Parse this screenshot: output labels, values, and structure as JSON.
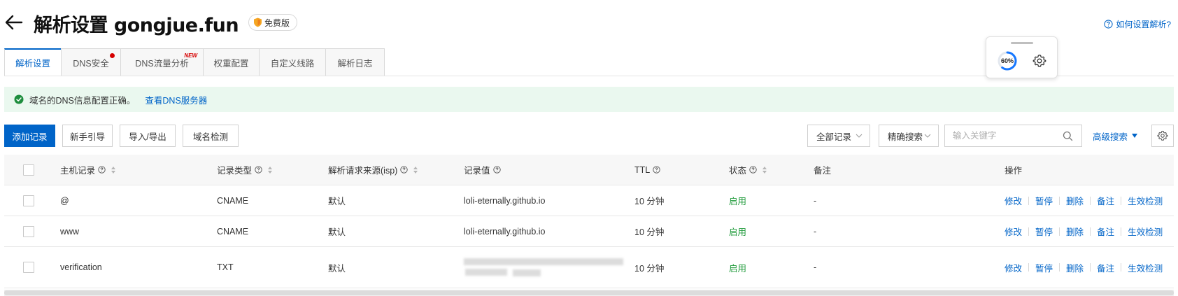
{
  "header": {
    "title": "解析设置 gongjue.fun",
    "edition_badge": "免费版",
    "help_link": "如何设置解析?"
  },
  "tabs": [
    {
      "label": "解析设置",
      "active": true
    },
    {
      "label": "DNS安全",
      "has_dot": true
    },
    {
      "label": "DNS流量分析",
      "badge": "NEW"
    },
    {
      "label": "权重配置"
    },
    {
      "label": "自定义线路"
    },
    {
      "label": "解析日志"
    }
  ],
  "widget": {
    "progress_label": "60%",
    "progress_value": 0.6,
    "icon": "gear-icon"
  },
  "alert": {
    "message": "域名的DNS信息配置正确。",
    "link": "查看DNS服务器"
  },
  "toolbar": {
    "add_record": "添加记录",
    "beginner_guide": "新手引导",
    "import_export": "导入/导出",
    "domain_check": "域名检测",
    "filter_select": "全部记录",
    "search_mode_select": "精确搜索",
    "search_placeholder": "输入关键字",
    "advanced_search": "高级搜索"
  },
  "table": {
    "columns": [
      "主机记录",
      "记录类型",
      "解析请求来源(isp)",
      "记录值",
      "TTL",
      "状态",
      "备注",
      "操作"
    ],
    "rows": [
      {
        "host": "@",
        "type": "CNAME",
        "isp": "默认",
        "value": "loli-eternally.github.io",
        "ttl": "10 分钟",
        "status": "启用",
        "remark": "-"
      },
      {
        "host": "www",
        "type": "CNAME",
        "isp": "默认",
        "value": "loli-eternally.github.io",
        "ttl": "10 分钟",
        "status": "启用",
        "remark": "-"
      },
      {
        "host": "verification",
        "type": "TXT",
        "isp": "默认",
        "value": "",
        "ttl": "10 分钟",
        "status": "启用",
        "remark": "-"
      }
    ],
    "actions": [
      "修改",
      "暂停",
      "删除",
      "备注",
      "生效检测"
    ]
  },
  "colors": {
    "primary": "#0064c8",
    "status_enabled": "#1f9a3a",
    "alert_bg": "#eaf8ef",
    "tab_dot": "#d60000"
  }
}
